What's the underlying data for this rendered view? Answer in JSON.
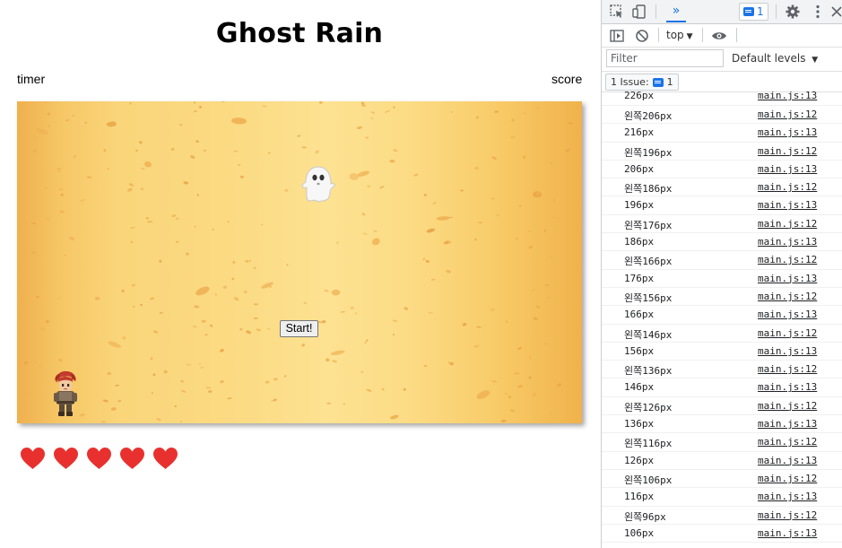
{
  "game": {
    "title": "Ghost Rain",
    "timer_label": "timer",
    "score_label": "score",
    "start_button": "Start!",
    "lives": 5
  },
  "devtools": {
    "more_tabs": "»",
    "issues_count": "1",
    "context": "top",
    "filter_placeholder": "Filter",
    "levels": "Default levels",
    "issues_chip": "1 Issue:",
    "issues_chip_count": "1",
    "log": [
      {
        "msg": "226px",
        "src": "main.js:13"
      },
      {
        "msg": "왼쪽206px",
        "src": "main.js:12"
      },
      {
        "msg": "216px",
        "src": "main.js:13"
      },
      {
        "msg": "왼쪽196px",
        "src": "main.js:12"
      },
      {
        "msg": "206px",
        "src": "main.js:13"
      },
      {
        "msg": "왼쪽186px",
        "src": "main.js:12"
      },
      {
        "msg": "196px",
        "src": "main.js:13"
      },
      {
        "msg": "왼쪽176px",
        "src": "main.js:12"
      },
      {
        "msg": "186px",
        "src": "main.js:13"
      },
      {
        "msg": "왼쪽166px",
        "src": "main.js:12"
      },
      {
        "msg": "176px",
        "src": "main.js:13"
      },
      {
        "msg": "왼쪽156px",
        "src": "main.js:12"
      },
      {
        "msg": "166px",
        "src": "main.js:13"
      },
      {
        "msg": "왼쪽146px",
        "src": "main.js:12"
      },
      {
        "msg": "156px",
        "src": "main.js:13"
      },
      {
        "msg": "왼쪽136px",
        "src": "main.js:12"
      },
      {
        "msg": "146px",
        "src": "main.js:13"
      },
      {
        "msg": "왼쪽126px",
        "src": "main.js:12"
      },
      {
        "msg": "136px",
        "src": "main.js:13"
      },
      {
        "msg": "왼쪽116px",
        "src": "main.js:12"
      },
      {
        "msg": "126px",
        "src": "main.js:13"
      },
      {
        "msg": "왼쪽106px",
        "src": "main.js:12"
      },
      {
        "msg": "116px",
        "src": "main.js:13"
      },
      {
        "msg": "왼쪽96px",
        "src": "main.js:12"
      },
      {
        "msg": "106px",
        "src": "main.js:13"
      }
    ]
  },
  "colors": {
    "heart": "#e8312e",
    "accent": "#1a73e8",
    "sand_light": "#fde292",
    "sand_dark": "#f0b04e"
  },
  "icons": [
    "inspect-icon",
    "device-toggle-icon",
    "settings-gear-icon",
    "kebab-menu-icon",
    "close-icon",
    "sidebar-toggle-icon",
    "clear-console-icon",
    "eye-icon",
    "heart-icon",
    "ghost-icon",
    "player-character-icon"
  ]
}
